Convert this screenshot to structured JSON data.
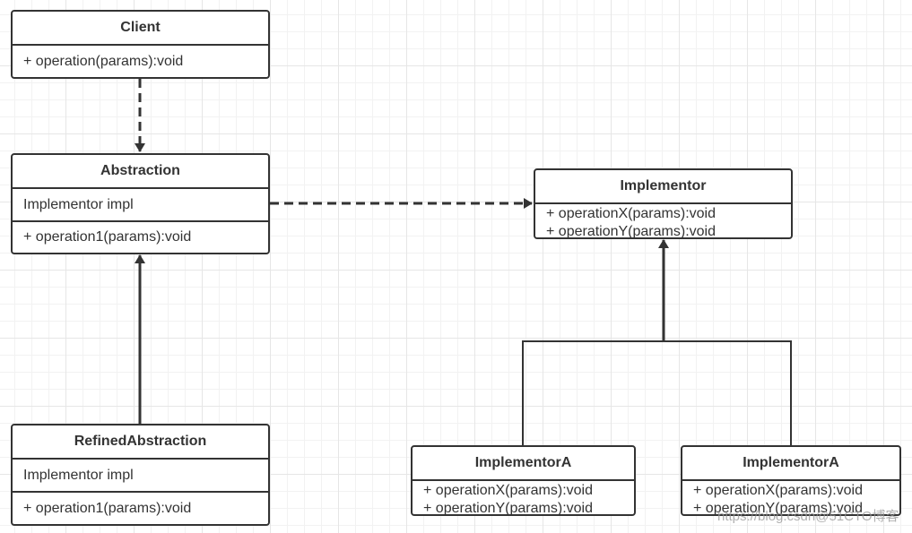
{
  "classes": {
    "client": {
      "name": "Client",
      "methods": [
        "+ operation(params):void"
      ]
    },
    "abstraction": {
      "name": "Abstraction",
      "fields": [
        "Implementor impl"
      ],
      "methods": [
        "+ operation1(params):void"
      ]
    },
    "refined": {
      "name": "RefinedAbstraction",
      "fields": [
        "Implementor impl"
      ],
      "methods": [
        "+ operation1(params):void"
      ]
    },
    "implementor": {
      "name": "Implementor",
      "methods": [
        "+ operationX(params):void",
        "+ operationY(params):void"
      ]
    },
    "implA1": {
      "name": "ImplementorA",
      "methods": [
        "+ operationX(params):void",
        "+ operationY(params):void"
      ]
    },
    "implA2": {
      "name": "ImplementorA",
      "methods": [
        "+ operationX(params):void",
        "+ operationY(params):void"
      ]
    }
  },
  "relations": [
    {
      "from": "Client",
      "to": "Abstraction",
      "type": "dependency"
    },
    {
      "from": "Abstraction",
      "to": "Implementor",
      "type": "dependency"
    },
    {
      "from": "RefinedAbstraction",
      "to": "Abstraction",
      "type": "association"
    },
    {
      "from": "ImplementorA",
      "to": "Implementor",
      "type": "generalization"
    },
    {
      "from": "ImplementorA",
      "to": "Implementor",
      "type": "generalization"
    }
  ],
  "watermark": "https://blog.csdn@51CTO博客",
  "colors": {
    "stroke": "#333333",
    "grid": "#e6e6e6"
  }
}
